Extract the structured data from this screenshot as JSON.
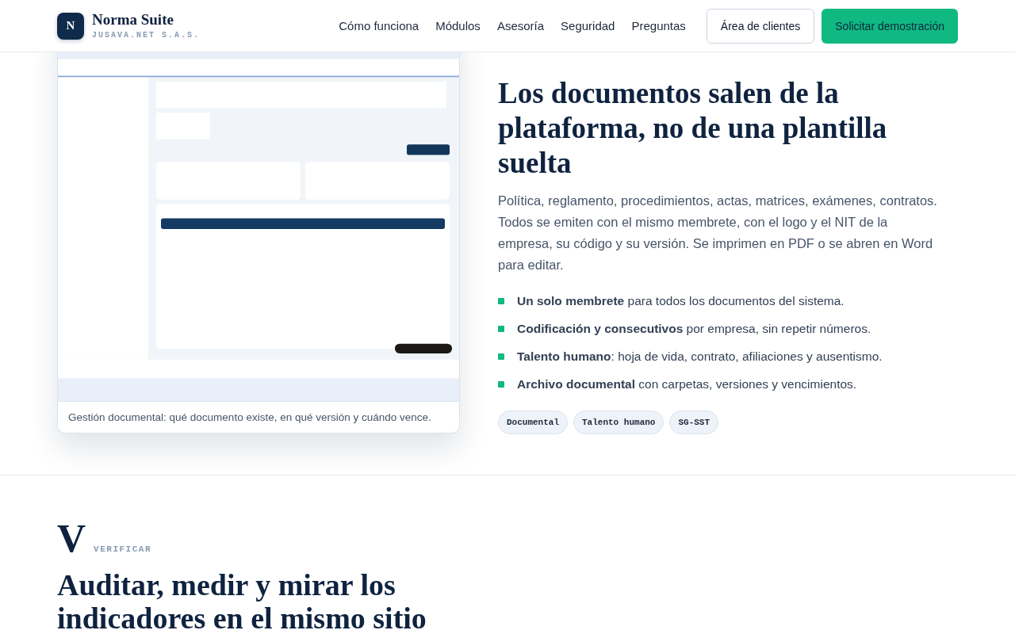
{
  "header": {
    "logo_letter": "N",
    "name": "Norma Suite",
    "company": "JUSAVA.NET S.A.S.",
    "nav": [
      "Cómo funciona",
      "Módulos",
      "Asesoría",
      "Seguridad",
      "Preguntas"
    ],
    "client_button": "Área de clientes",
    "demo_button": "Solicitar demostración"
  },
  "feature": {
    "screenshot": {
      "kind": "picture"
    },
    "caption": "Gestión documental: qué documento existe, en qué versión y cuándo vence.",
    "title": "Los documentos salen de la plataforma, no de una plantilla suelta",
    "paragraph": "Política, reglamento, procedimientos, actas, matrices, exámenes, contratos. Todos se emiten con el mismo membrete, con el logo y el NIT de la empresa, su código y su versión. Se imprimen en PDF o se abren en Word para editar.",
    "bullets": [
      "**Un solo membrete** para todos los documentos del sistema.",
      "**Codificación y consecutivos** por empresa, sin repetir números.",
      "**Talento humano**: hoja de vida, contrato, afiliaciones y ausentismo.",
      "**Archivo documental** con carpetas, versiones y vencimientos."
    ],
    "tags": [
      "Documental",
      "Talento humano",
      "SG-SST"
    ]
  },
  "next_section": {
    "numeral": "V",
    "eyebrow": "VERIFICAR",
    "title": "Auditar, medir y mirar los indicadores en el mismo sitio"
  }
}
